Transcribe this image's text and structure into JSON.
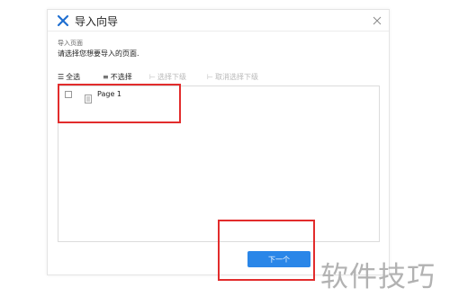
{
  "dialog": {
    "title": "导入向导",
    "section_label": "导入页面",
    "instruction": "请选择您想要导入的页面."
  },
  "toolbar": {
    "select_all": "全选",
    "select_none": "不选择",
    "select_children": "选择下级",
    "deselect_children": "取消选择下级"
  },
  "pages": [
    {
      "label": "Page 1",
      "checked": false
    }
  ],
  "buttons": {
    "next": "下一个"
  },
  "watermark": "软件技巧",
  "colors": {
    "accent": "#2a86e8",
    "highlight": "#e22c2c",
    "logo": "#1f6fd1"
  }
}
